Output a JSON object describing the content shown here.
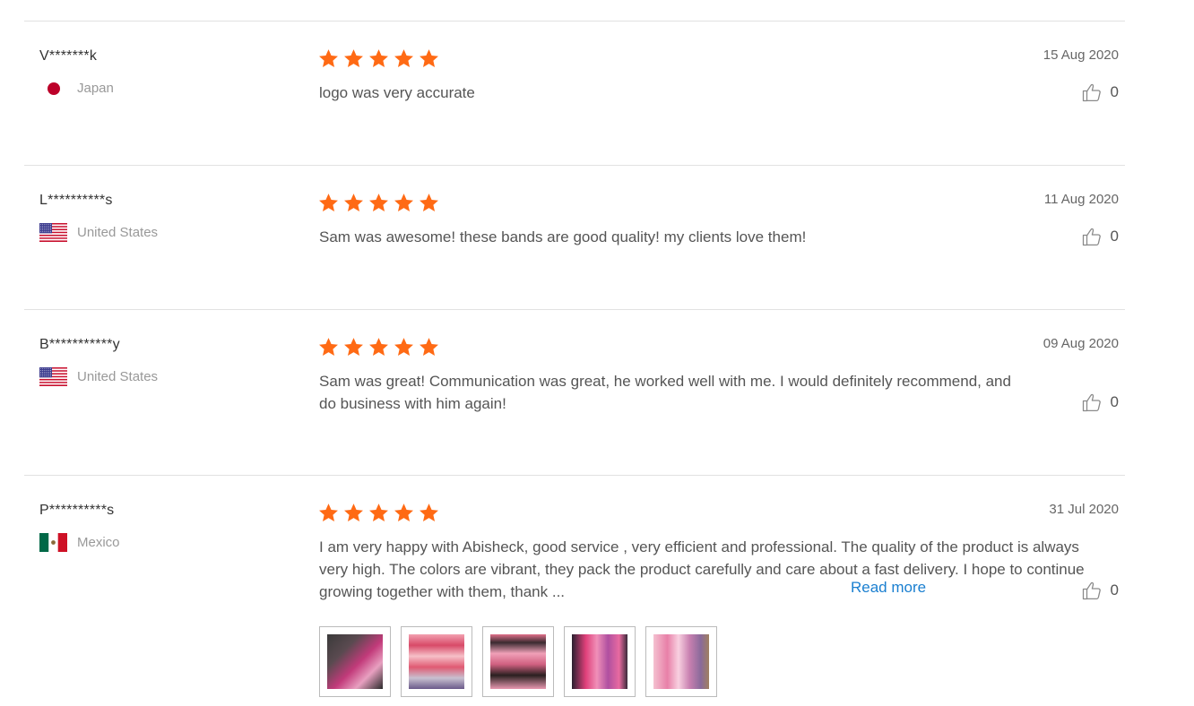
{
  "reviews": [
    {
      "user": "V*******k",
      "country": "Japan",
      "rating": 5,
      "text": "logo was very accurate",
      "date": "15 Aug 2020",
      "helpful_count": "0"
    },
    {
      "user": "L**********s",
      "country": "United States",
      "rating": 5,
      "text": "Sam was awesome! these bands are good quality! my clients love them!",
      "date": "11 Aug 2020",
      "helpful_count": "0"
    },
    {
      "user": "B***********y",
      "country": "United States",
      "rating": 5,
      "text": "Sam was great! Communication was great, he worked well with me. I would definitely recommend, and do business with him again!",
      "date": "09 Aug 2020",
      "helpful_count": "0"
    },
    {
      "user": "P**********s",
      "country": "Mexico",
      "rating": 5,
      "text": "I am very happy with Abisheck, good service , very efficient and professional.  The quality of the product is always very high. The colors are vibrant, they pack the product carefully and care about a fast delivery.  I hope to continue growing together with them, thank ...",
      "read_more": "Read more",
      "date": "31 Jul 2020",
      "helpful_count": "0",
      "photos": [
        "photo-1",
        "photo-2",
        "photo-3",
        "photo-4",
        "photo-5"
      ]
    }
  ],
  "colors": {
    "star": "#ff6a14",
    "link": "#1a7fd0",
    "divider": "#e2e2e2",
    "muted_text": "#999999"
  },
  "icons": [
    "star-icon",
    "thumbs-up-icon",
    "flag-japan-icon",
    "flag-usa-icon",
    "flag-mexico-icon"
  ]
}
